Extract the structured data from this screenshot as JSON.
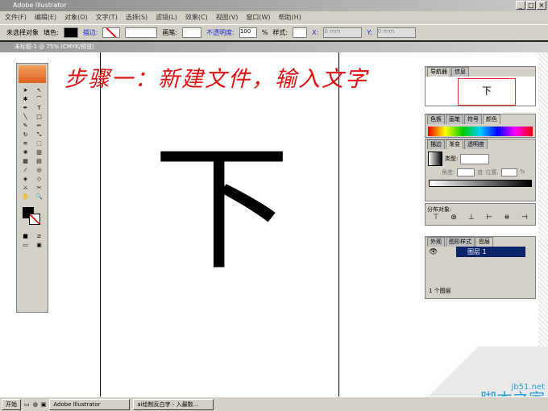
{
  "app": {
    "title": "Adobe Illustrator"
  },
  "menu": [
    "文件(F)",
    "编辑(E)",
    "对象(O)",
    "文字(T)",
    "选择(S)",
    "滤镜(L)",
    "效果(C)",
    "视图(V)",
    "窗口(W)",
    "帮助(H)"
  ],
  "control": {
    "selection": "未选择对象",
    "fill": "填色:",
    "stroke": "描边:",
    "style": "画笔:",
    "opacity": "不透明度:",
    "opacity_value": "100",
    "percent": "%",
    "blend": "样式:",
    "x_label": "X:",
    "x_value": "0 mm",
    "y_label": "Y:",
    "y_value": "0 mm"
  },
  "document": {
    "title": "未标题-1 @ 75% (CMYK/预览)"
  },
  "annotation": "步骤一：新建文件，输入文字",
  "canvas_text": "下",
  "panels": {
    "navigator": {
      "tabs": [
        "导航器",
        "信息"
      ]
    },
    "color": {
      "tabs": [
        "色板",
        "画笔",
        "符号",
        "颜色"
      ]
    },
    "gradient": {
      "tabs": [
        "描边",
        "渐变",
        "透明度"
      ],
      "type_label": "类型:",
      "angle_label": "角度:",
      "degree": "度",
      "location_label": "位置:",
      "percent": "%"
    },
    "distribute": {
      "label": "分布对象:"
    },
    "layers": {
      "tabs": [
        "外观",
        "图形样式",
        "图层"
      ],
      "layer_name": "图层 1",
      "footer": "1 个图层"
    }
  },
  "taskbar": {
    "start": "开始",
    "tasks": [
      "Adobe Illustrator",
      "ai绘制反白字 - 入最数..."
    ]
  },
  "watermark": {
    "url": "jb51.net",
    "brand": "脚本之家"
  }
}
